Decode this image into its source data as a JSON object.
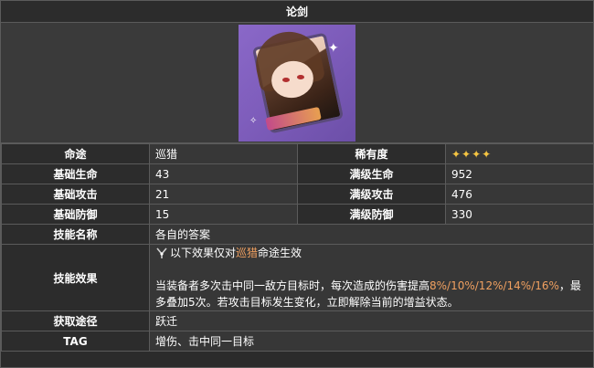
{
  "title": "论剑",
  "rows": {
    "path": {
      "label": "命途",
      "value": "巡猎"
    },
    "rarity": {
      "label": "稀有度",
      "stars": "✦✦✦✦"
    },
    "base_hp": {
      "label": "基础生命",
      "value": "43"
    },
    "max_hp": {
      "label": "满级生命",
      "value": "952"
    },
    "base_atk": {
      "label": "基础攻击",
      "value": "21"
    },
    "max_atk": {
      "label": "满级攻击",
      "value": "476"
    },
    "base_def": {
      "label": "基础防御",
      "value": "15"
    },
    "max_def": {
      "label": "满级防御",
      "value": "330"
    },
    "skill_name": {
      "label": "技能名称",
      "value": "各自的答案"
    },
    "skill_effect": {
      "label": "技能效果",
      "prefix": "以下效果仅对",
      "path_highlight": "巡猎",
      "suffix": "命途生效",
      "desc_a": "当装备者多次击中同一敌方目标时，每次造成的伤害提高",
      "desc_values": "8%/10%/12%/14%/16%",
      "desc_b": "，最多叠加5次。若攻击目标发生变化，立即解除当前的增益状态。"
    },
    "obtain": {
      "label": "获取途径",
      "value": "跃迁"
    },
    "tag": {
      "label": "TAG",
      "value": "增伤、击中同一目标"
    }
  },
  "colors": {
    "highlight": "#f0a060",
    "star": "#f5c542"
  },
  "icons": {
    "portrait": "light-cone-portrait",
    "path": "hunt-path-icon"
  }
}
